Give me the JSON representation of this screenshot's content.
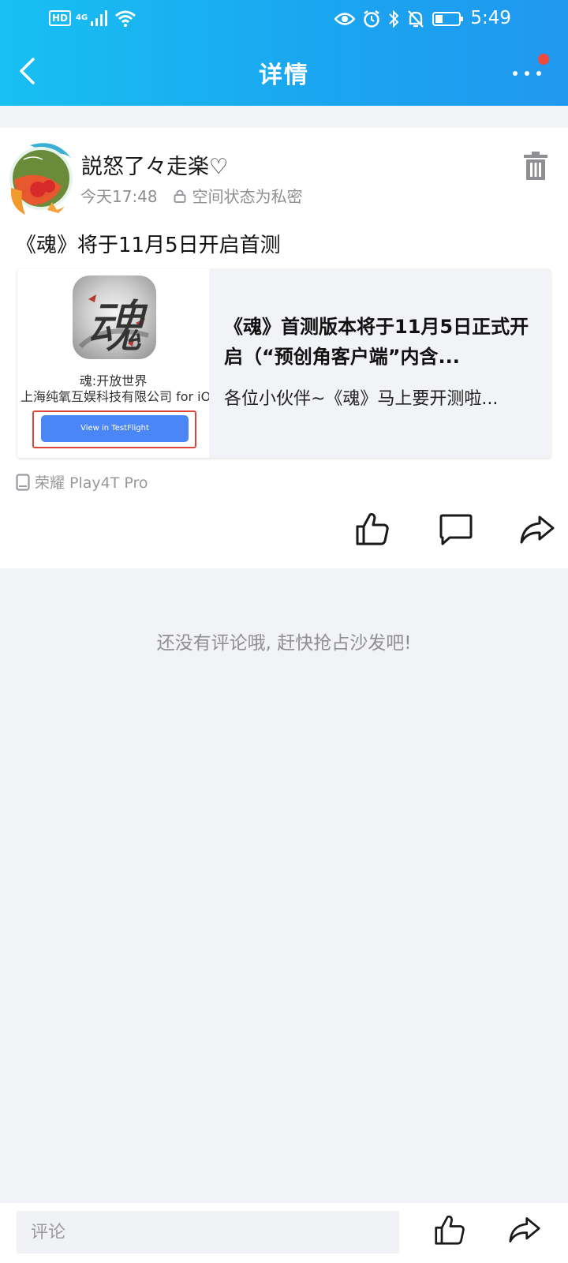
{
  "status_bar": {
    "hd": "HD",
    "network": "4G",
    "time": "5:49"
  },
  "header": {
    "title": "详情"
  },
  "post": {
    "author": "説怒了々走楽♡",
    "time": "今天17:48",
    "privacy": "空间状态为私密",
    "text": "《魂》将于11月5日开启首测",
    "device": "荣耀 Play4T Pro"
  },
  "link_card": {
    "app_name": "魂:开放世界",
    "company": "上海纯氧互娱科技有限公司 for iOS",
    "button_label": "View in TestFlight",
    "icon_glyph": "魂",
    "title": "《魂》首测版本将于11月5日正式开启（“预创角客户端”内含...",
    "description": "各位小伙伴~《魂》马上要开测啦..."
  },
  "comments": {
    "empty_text": "还没有评论哦, 赶快抢占沙发吧!"
  },
  "bottom_bar": {
    "comment_placeholder": "评论"
  },
  "colors": {
    "header_gradient_start": "#18c0f2",
    "header_gradient_end": "#2098ef",
    "notification_dot": "#f0493d",
    "testflight_button": "#4a86f6"
  },
  "icons": [
    "back-arrow-icon",
    "more-icon",
    "delete-icon",
    "lock-icon",
    "phone-icon",
    "like-icon",
    "comment-icon",
    "share-icon"
  ]
}
